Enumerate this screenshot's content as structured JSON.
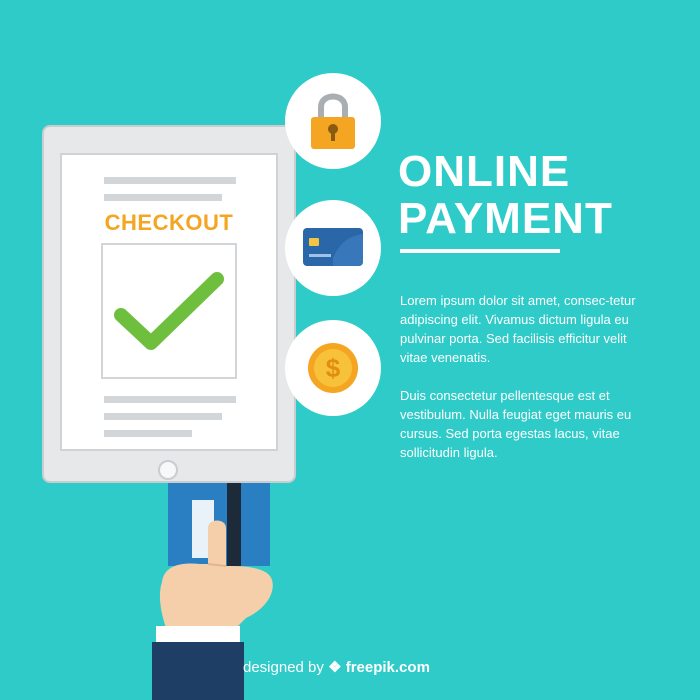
{
  "checkout": {
    "label": "CHECKOUT"
  },
  "headline": {
    "line1": "ONLINE",
    "line2": "PAYMENT"
  },
  "paragraphs": [
    "Lorem ipsum dolor sit amet, consec-tetur adipiscing elit. Vivamus dictum ligula eu pulvinar porta. Sed facilisis efficitur velit vitae venenatis.",
    "Duis consectetur pellentesque est et vestibulum. Nulla feugiat eget mauris eu cursus. Sed porta egestas lacus, vitae sollicitudin ligula."
  ],
  "credit": {
    "prefix": "designed by",
    "brand": "freepik.com"
  },
  "icons": [
    "padlock-icon",
    "credit-card-icon",
    "dollar-coin-icon",
    "checkmark-icon"
  ],
  "colors": {
    "background": "#2ecbc9",
    "accent_orange": "#f4a623",
    "check_green": "#6fbf3f",
    "card_blue": "#2a7fc2",
    "sleeve_navy": "#1f3e66"
  }
}
